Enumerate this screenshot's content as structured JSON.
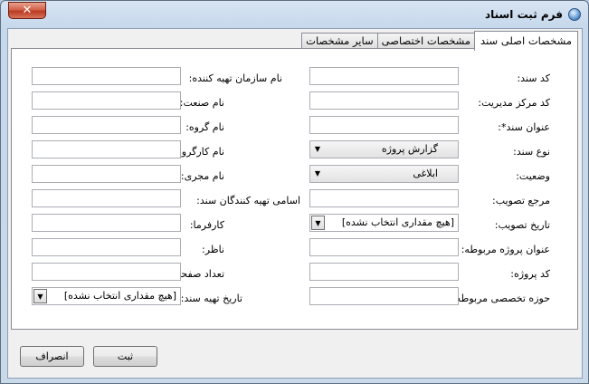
{
  "window": {
    "title": "فرم ثبت اسناد",
    "close_label": "✕"
  },
  "tabs": [
    {
      "label": "مشخصات اصلی سند",
      "active": true
    },
    {
      "label": "مشخصات اختصاصی",
      "active": false
    },
    {
      "label": "سایر مشخصات",
      "active": false
    }
  ],
  "right_fields": {
    "doc_code": {
      "label": "کد سند:",
      "value": ""
    },
    "mgmt_center_code": {
      "label": "کد مرکز مدیریت:",
      "value": ""
    },
    "doc_title": {
      "label": "عنوان سند*:",
      "value": ""
    },
    "doc_type": {
      "label": "نوع سند:",
      "value": "گزارش پروژه"
    },
    "status": {
      "label": "وضعیت:",
      "value": "ابلاغی"
    },
    "approval_ref": {
      "label": "مرجع تصویب:",
      "value": ""
    },
    "approval_date": {
      "label": "تاریخ تصویب:",
      "value": "[هیچ مقداری انتخاب نشده]"
    },
    "related_project_title": {
      "label": "عنوان پروژه مربوطه:",
      "value": ""
    },
    "project_code": {
      "label": "کد پروژه:",
      "value": ""
    },
    "related_specialty": {
      "label": "حوزه تخصصی مربوطه:",
      "value": ""
    }
  },
  "left_fields": {
    "preparer_org": {
      "label": "نام سازمان تهیه کننده:",
      "value": ""
    },
    "industry": {
      "label": "نام صنعت:",
      "value": ""
    },
    "group": {
      "label": "نام گروه:",
      "value": ""
    },
    "workgroup": {
      "label": "نام کارگروه:",
      "value": ""
    },
    "executor": {
      "label": "نام مجری:",
      "value": ""
    },
    "preparers": {
      "label": "اسامی تهیه کنندگان سند:",
      "value": ""
    },
    "employer": {
      "label": "کارفرما:",
      "value": ""
    },
    "supervisor": {
      "label": "ناظر:",
      "value": ""
    },
    "page_count": {
      "label": "تعداد صفحه:",
      "value": ""
    },
    "prep_date": {
      "label": "تاریخ تهیه سند:",
      "value": "[هیچ مقداری انتخاب نشده]"
    }
  },
  "buttons": {
    "save": "ثبت",
    "cancel": "انصراف"
  },
  "icons": {
    "app": "document-icon",
    "close": "close-icon",
    "dropdown": "chevron-down-icon"
  },
  "colors": {
    "frame": "#c6d8ec",
    "close": "#c94a32"
  }
}
